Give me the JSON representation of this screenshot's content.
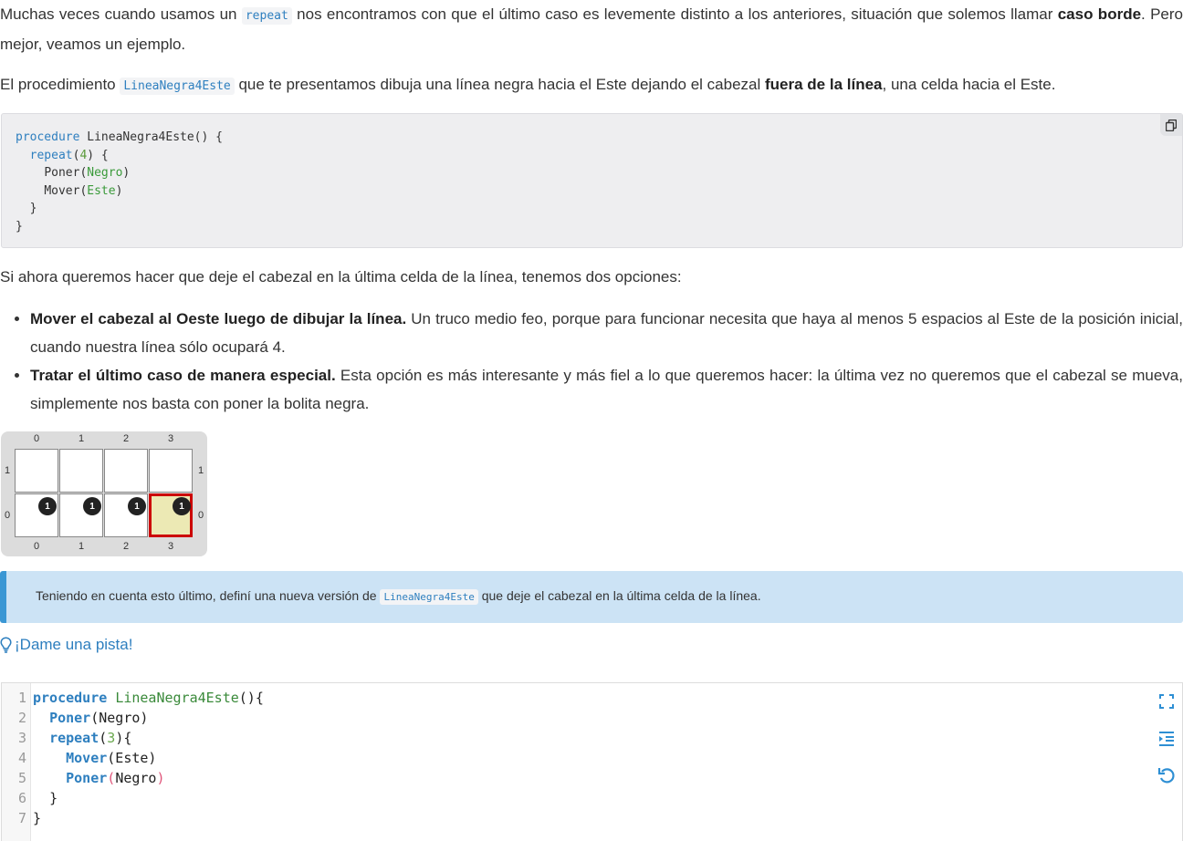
{
  "intro": {
    "p1_a": "Muchas veces cuando usamos un ",
    "p1_code": "repeat",
    "p1_b": " nos encontramos con que el último caso es levemente distinto a los anteriores, situación que solemos llamar ",
    "p1_bold": "caso borde",
    "p1_c": ". Pero mejor, veamos un ejemplo.",
    "p2_a": "El procedimiento ",
    "p2_code": "LineaNegra4Este",
    "p2_b": " que te presentamos dibuja una línea negra hacia el Este dejando el cabezal ",
    "p2_bold": "fuera de la línea",
    "p2_c": ", una celda hacia el Este."
  },
  "example_code": {
    "l1_kw": "procedure",
    "l1_rest": " LineaNegra4Este() {",
    "l2_kw": "repeat",
    "l2_num": "4",
    "l3_fn": "Poner",
    "l3_arg": "Negro",
    "l4_fn": "Mover",
    "l4_arg": "Este",
    "copy_icon": "copy-icon"
  },
  "options_intro": "Si ahora queremos hacer que deje el cabezal en la última celda de la línea, tenemos dos opciones:",
  "options": [
    {
      "bold": "Mover el cabezal al Oeste luego de dibujar la línea.",
      "text": " Un truco medio feo, porque para funcionar necesita que haya al menos 5 espacios al Este de la posición inicial, cuando nuestra línea sólo ocupará 4."
    },
    {
      "bold": "Tratar el último caso de manera especial.",
      "text": " Esta opción es más interesante y más fiel a lo que queremos hacer: la última vez no queremos que el cabezal se mueva, simplemente nos basta con poner la bolita negra."
    }
  ],
  "board": {
    "cols": [
      "0",
      "1",
      "2",
      "3"
    ],
    "rows": [
      "1",
      "0"
    ],
    "ball_count": "1",
    "head_cell": "row 0, col 3",
    "head_color": "#c00000",
    "ball_color": "#222222"
  },
  "callout": {
    "a": "Teniendo en cuenta esto último, definí una nueva versión de ",
    "code": "LineaNegra4Este",
    "b": " que deje el cabezal en la última celda de la línea.",
    "accent": "#3a97d4"
  },
  "hint": {
    "label": "¡Dame una pista!",
    "icon": "lightbulb-icon"
  },
  "editor": {
    "line_numbers": [
      "1",
      "2",
      "3",
      "4",
      "5",
      "6",
      "7"
    ],
    "l1_kw": "procedure",
    "l1_name": "LineaNegra4Este",
    "l1_rest": "(){",
    "l2_fn": "Poner",
    "l2_arg": "(Negro)",
    "l3_kw": "repeat",
    "l3_num": "3",
    "l4_fn": "Mover",
    "l4_arg": "(Este)",
    "l5_fn": "Poner",
    "l5_arg": "Negro",
    "l6": "}",
    "l7": "}",
    "icons": [
      "fullscreen-icon",
      "indent-icon",
      "reset-icon"
    ]
  }
}
